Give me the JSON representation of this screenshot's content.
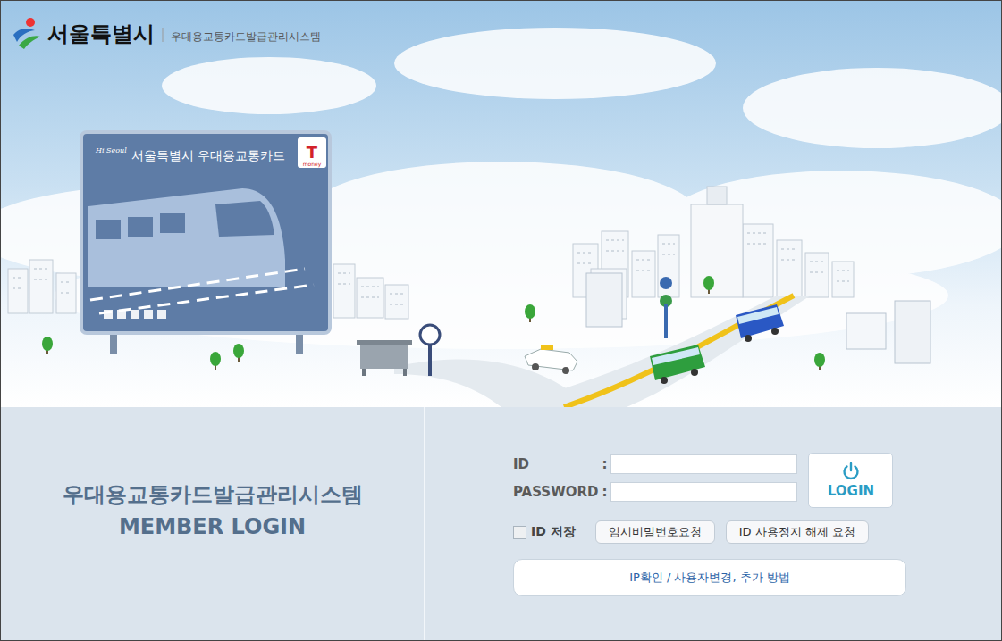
{
  "header": {
    "logo": "서울특별시",
    "system_name": "우대용교통카드발급관리시스템"
  },
  "billboard": {
    "tagline": "Hi Seoul",
    "title": "서울특별시 우대용교통카드",
    "badge": "T",
    "badge_caption": "money"
  },
  "login_panel": {
    "title": "우대용교통카드발급관리시스템",
    "subtitle": "MEMBER LOGIN"
  },
  "form": {
    "fields": [
      {
        "label": "ID",
        "separator": ":",
        "value": ""
      },
      {
        "label": "PASSWORD",
        "separator": ":",
        "value": ""
      }
    ],
    "login_button": "LOGIN",
    "save_id": {
      "label": "ID 저장",
      "checked": false
    },
    "buttons": [
      "임시비밀번호요청",
      "ID 사용정지 해제 요청"
    ],
    "help_button": "IP확인 / 사용자변경, 추가 방법"
  }
}
